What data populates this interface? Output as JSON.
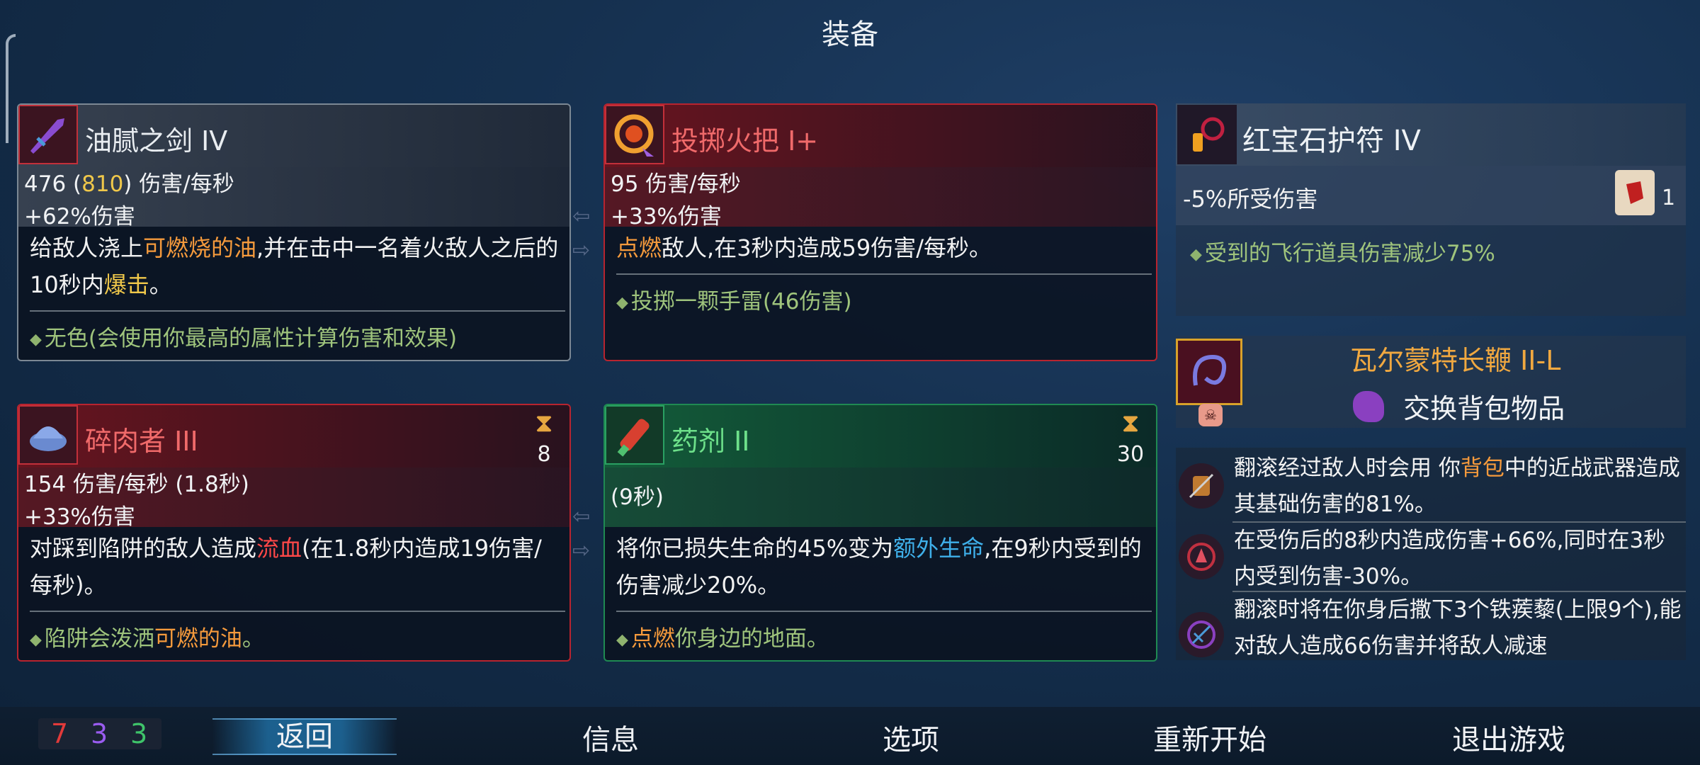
{
  "header": {
    "title": "装备"
  },
  "cards": {
    "sword": {
      "name": "油腻之剑 IV",
      "stat_dps_prefix": "476 (",
      "stat_dps_crit": "810",
      "stat_dps_suffix": ") 伤害/每秒",
      "stat_bonus": "+62%伤害",
      "desc_1": "给敌人浇上",
      "desc_hl1": "可燃烧的油",
      "desc_2": ",并在击中一名着火敌人之后的10秒内",
      "desc_hl2": "爆击",
      "desc_3": "。",
      "bonus": "无色(会使用你最高的属性计算伤害和效果)"
    },
    "torch": {
      "name": "投掷火把 I+",
      "stat_dps": "95 伤害/每秒",
      "stat_bonus": "+33%伤害",
      "desc_hl1": "点燃",
      "desc_1": "敌人,在3秒内造成59伤害/每秒。",
      "bonus": "投掷一颗手雷(46伤害)"
    },
    "butcher": {
      "name": "碎肉者 III",
      "cooldown": "8",
      "stat_dps": "154 伤害/每秒 (1.8秒)",
      "stat_bonus": "+33%伤害",
      "desc_1": "对踩到陷阱的敌人造成",
      "desc_hl1": "流血",
      "desc_2": "(在1.8秒内造成19伤害/每秒)。",
      "bonus_1": "陷阱会泼洒",
      "bonus_hl": "可燃的油",
      "bonus_2": "。"
    },
    "potion": {
      "name": "药剂 II",
      "cooldown": "30",
      "stat_time": "(9秒)",
      "desc_1": "将你已损失生命的45%变为",
      "desc_hl1": "额外生命",
      "desc_2": ",在9秒内受到的伤害减少20%。",
      "bonus_hl": "点燃",
      "bonus_1": "你身边的地面。"
    }
  },
  "amulet": {
    "name": "红宝石护符 IV",
    "stat": "-5%所受伤害",
    "scroll_count": "1",
    "bonus": "受到的飞行道具伤害减少75%"
  },
  "whip": {
    "name": "瓦尔蒙特长鞭 II-L",
    "action": "交换背包物品"
  },
  "mutations": [
    {
      "text_1": "翻滚经过敌人时会用 你",
      "hl": "背包",
      "text_2": "中的近战武器造成其基础伤害的81%。"
    },
    {
      "text_1": "在受伤后的8秒内造成伤害+66%,同时在3秒内受到伤害-30%。",
      "hl": "",
      "text_2": ""
    },
    {
      "text_1": "翻滚时将在你身后撒下3个铁蒺藜(上限9个),能对敌人造成66伤害并将敌人减速",
      "hl": "",
      "text_2": ""
    }
  ],
  "scrolls": {
    "brutality": "7",
    "tactics": "3",
    "survival": "3"
  },
  "menu": {
    "back": "返回",
    "info": "信息",
    "options": "选项",
    "restart": "重新开始",
    "quit": "退出游戏"
  },
  "colors": {
    "brutality": "#e23a3a",
    "tactics": "#9a5cf0",
    "survival": "#3fc46a",
    "highlight_orange": "#f59a3c",
    "highlight_blue": "#3fb0ea"
  }
}
